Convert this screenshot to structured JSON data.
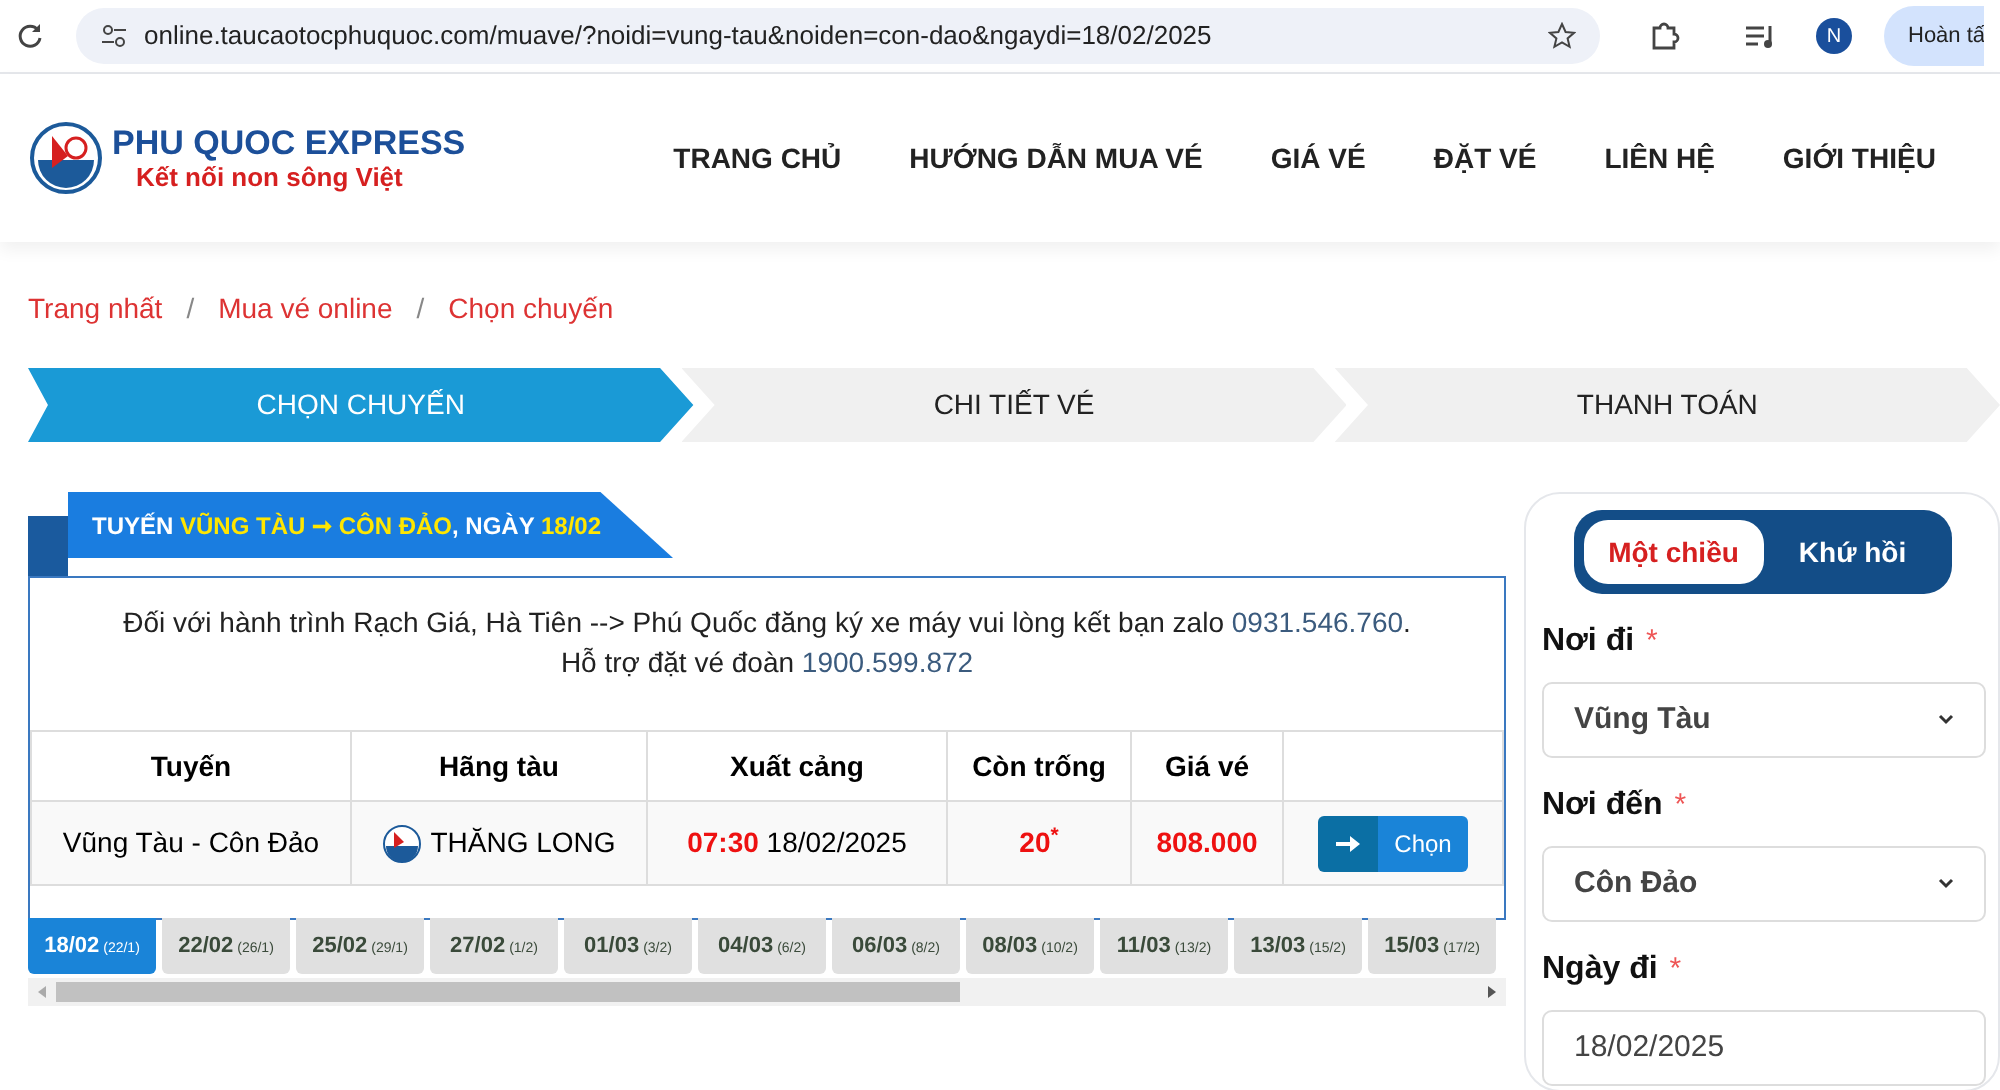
{
  "browser": {
    "url": "online.taucaotocphuquoc.com/muave/?noidi=vung-tau&noiden=con-dao&ngaydi=18/02/2025",
    "profile": "N",
    "button": "Hoàn tấ"
  },
  "logo": {
    "name": "PHU QUOC EXPRESS",
    "tagline": "Kết nối non sông Việt"
  },
  "nav": [
    "TRANG CHỦ",
    "HƯỚNG DẪN MUA VÉ",
    "GIÁ VÉ",
    "ĐẶT VÉ",
    "LIÊN HỆ",
    "GIỚI THIỆU"
  ],
  "breadcrumb": [
    "Trang nhất",
    "Mua vé online",
    "Chọn chuyến"
  ],
  "breadcrumb_separator": "/",
  "steps": [
    {
      "label": "CHỌN CHUYẾN",
      "selected": true
    },
    {
      "label": "CHI TIẾT VÉ",
      "selected": false
    },
    {
      "label": "THANH TOÁN",
      "selected": false
    }
  ],
  "route_heading": [
    {
      "text": "TUYẾN ",
      "highlight": false
    },
    {
      "text": "VŨNG TÀU ➞ CÔN ĐẢO",
      "highlight": true
    },
    {
      "text": ", NGÀY ",
      "highlight": false
    },
    {
      "text": "18/02",
      "highlight": true
    }
  ],
  "notice": [
    [
      {
        "text": "Đối với hành trình Rạch Giá, Hà Tiên --> Phú Quốc đăng ký xe máy vui lòng kết bạn zalo ",
        "kind": "text"
      },
      {
        "text": "0931.546.760",
        "kind": "phone"
      },
      {
        "text": ".",
        "kind": "text"
      }
    ],
    [
      {
        "text": "Hỗ trợ đặt vé đoàn ",
        "kind": "text"
      },
      {
        "text": "1900.599.872",
        "kind": "phone"
      }
    ]
  ],
  "table": {
    "columns": [
      "Tuyến",
      "Hãng tàu",
      "Xuất cảng",
      "Còn trống",
      "Giá vé"
    ],
    "rows": [
      {
        "route": "Vũng Tàu - Côn Đảo",
        "operator": "THĂNG LONG",
        "time": "07:30",
        "date": "18/02/2025",
        "seats": "20",
        "seats_mark": "*",
        "price": "808.000",
        "action": "Chọn"
      }
    ]
  },
  "dates": [
    {
      "date": "18/02",
      "lunar": "(22/1)",
      "selected": true
    },
    {
      "date": "22/02",
      "lunar": "(26/1)",
      "selected": false
    },
    {
      "date": "25/02",
      "lunar": "(29/1)",
      "selected": false
    },
    {
      "date": "27/02",
      "lunar": "(1/2)",
      "selected": false
    },
    {
      "date": "01/03",
      "lunar": "(3/2)",
      "selected": false
    },
    {
      "date": "04/03",
      "lunar": "(6/2)",
      "selected": false
    },
    {
      "date": "06/03",
      "lunar": "(8/2)",
      "selected": false
    },
    {
      "date": "08/03",
      "lunar": "(10/2)",
      "selected": false
    },
    {
      "date": "11/03",
      "lunar": "(13/2)",
      "selected": false
    },
    {
      "date": "13/03",
      "lunar": "(15/2)",
      "selected": false
    },
    {
      "date": "15/03",
      "lunar": "(17/2)",
      "selected": false
    }
  ],
  "trip_type": [
    {
      "label": "Một chiều",
      "selected": true
    },
    {
      "label": "Khứ hồi",
      "selected": false
    }
  ],
  "form": [
    {
      "label": "Nơi đi",
      "required": true,
      "kind": "select",
      "value": "Vũng Tàu"
    },
    {
      "label": "Nơi đến",
      "required": true,
      "kind": "select",
      "value": "Côn Đảo"
    },
    {
      "label": "Ngày đi",
      "required": true,
      "kind": "input",
      "value": "18/02/2025"
    }
  ]
}
